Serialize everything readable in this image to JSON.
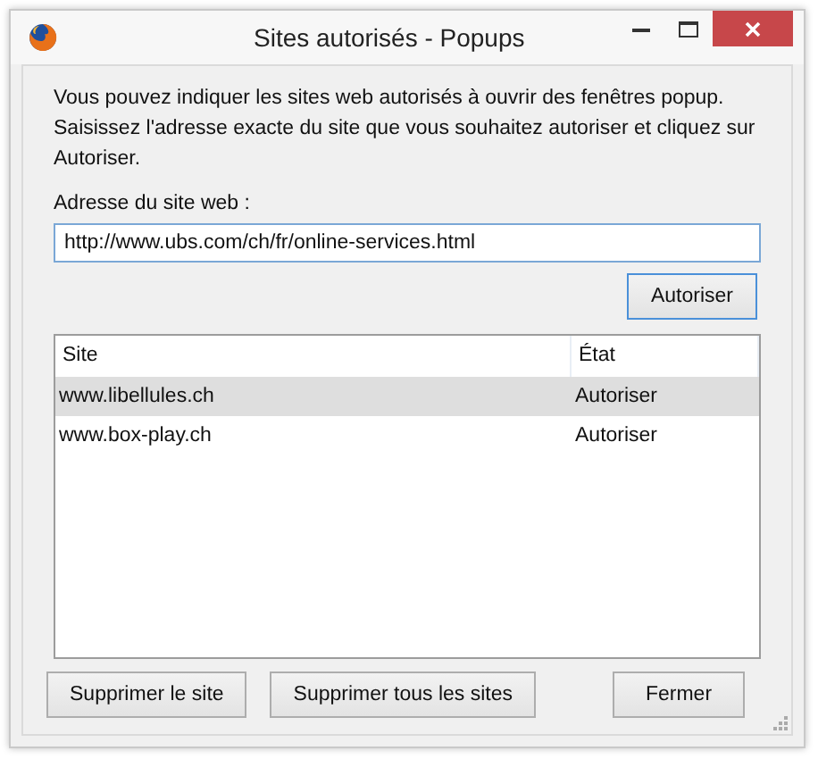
{
  "window": {
    "title": "Sites autorisés - Popups",
    "controls": [
      {
        "kind": "minimize"
      },
      {
        "kind": "maximize"
      },
      {
        "kind": "close"
      }
    ]
  },
  "description": "Vous pouvez indiquer les sites web autorisés à ouvrir des fenêtres popup. Saisissez l'adresse exacte du site que vous souhaitez autoriser et cliquez sur Autoriser.",
  "address": {
    "label": "Adresse du site web :",
    "value": "http://www.ubs.com/ch/fr/online-services.html"
  },
  "allow_button": {
    "label": "Autoriser"
  },
  "table": {
    "columns": [
      "Site",
      "État"
    ],
    "rows": [
      {
        "site": "www.libellules.ch",
        "state": "Autoriser",
        "selected": true
      },
      {
        "site": "www.box-play.ch",
        "state": "Autoriser",
        "selected": false
      }
    ]
  },
  "buttons": [
    {
      "label": "Supprimer le site",
      "kind": "left"
    },
    {
      "label": "Supprimer tous les sites",
      "kind": "left"
    },
    {
      "label": "Fermer",
      "kind": "right"
    }
  ]
}
